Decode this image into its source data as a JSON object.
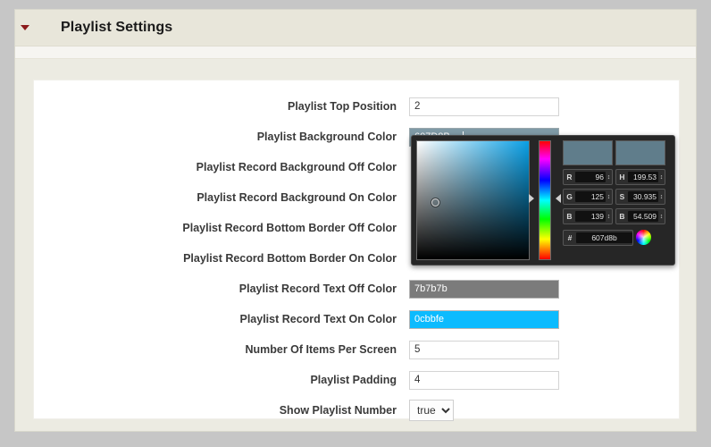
{
  "window": {
    "title": "Playlist Settings",
    "collapse_icon": "caret-down-icon"
  },
  "form": {
    "rows": [
      {
        "label": "Playlist Top Position",
        "value": "2",
        "kind": "text"
      },
      {
        "label": "Playlist Background Color",
        "value": "607D8B",
        "kind": "color",
        "swatch": "#607d8b",
        "focused": true
      },
      {
        "label": "Playlist Record Background Off Color",
        "value": "",
        "kind": "hidden"
      },
      {
        "label": "Playlist Record Background On Color",
        "value": "",
        "kind": "hidden"
      },
      {
        "label": "Playlist Record Bottom Border Off Color",
        "value": "",
        "kind": "hidden"
      },
      {
        "label": "Playlist Record Bottom Border On Color",
        "value": "",
        "kind": "hidden"
      },
      {
        "label": "Playlist Record Text Off Color",
        "value": "7b7b7b",
        "kind": "color",
        "swatch": "#7b7b7b"
      },
      {
        "label": "Playlist Record Text On Color",
        "value": "0cbbfe",
        "kind": "color",
        "swatch": "#0cbbfe"
      },
      {
        "label": "Number Of Items Per Screen",
        "value": "5",
        "kind": "text"
      },
      {
        "label": "Playlist Padding",
        "value": "4",
        "kind": "text"
      },
      {
        "label": "Show Playlist Number",
        "value": "true",
        "kind": "select",
        "options": [
          "true",
          "false"
        ]
      }
    ]
  },
  "color_picker": {
    "preview_current": "#607d8b",
    "preview_previous": "#607d8b",
    "hue_slider_icon": "hue-slider",
    "wheel_icon": "color-wheel-icon",
    "rgb": [
      {
        "key": "R",
        "value": "96"
      },
      {
        "key": "G",
        "value": "125"
      },
      {
        "key": "B",
        "value": "139"
      }
    ],
    "hsb": [
      {
        "key": "H",
        "value": "199.53"
      },
      {
        "key": "S",
        "value": "30.935"
      },
      {
        "key": "B",
        "value": "54.509"
      }
    ],
    "hex_key": "#",
    "hex_value": "607d8b",
    "spinner_glyph": "↕"
  }
}
